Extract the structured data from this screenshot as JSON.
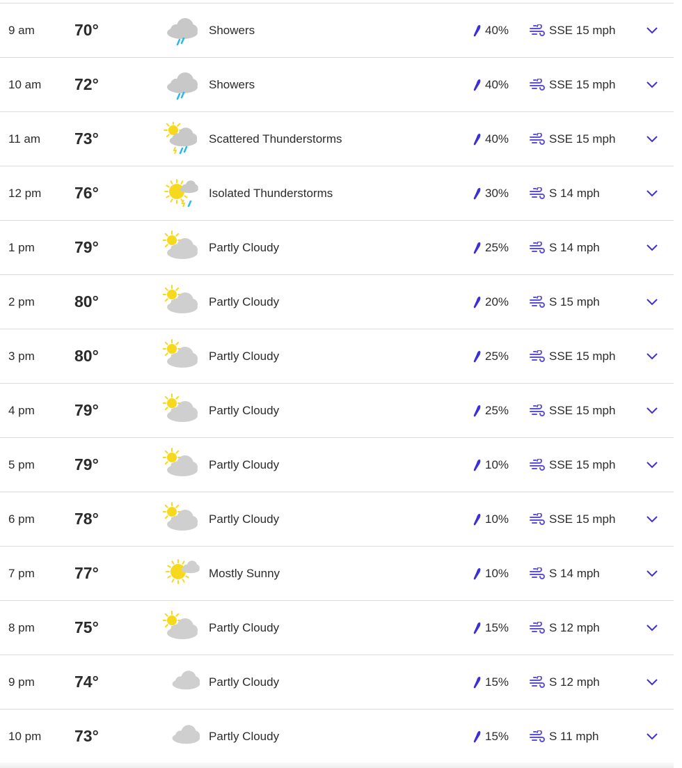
{
  "colors": {
    "accent": "#3d2fd6",
    "wind": "#5b4fe0",
    "divider": "#dcdcdc",
    "text": "#2b2b2b",
    "cloud": "#cfcfcf",
    "sun": "#f6d81c",
    "rain": "#2fb6e8"
  },
  "rows": [
    {
      "time": "9 am",
      "temp": "70°",
      "icon": "showers-icon",
      "condition": "Showers",
      "precip": "40%",
      "wind": "SSE 15 mph"
    },
    {
      "time": "10 am",
      "temp": "72°",
      "icon": "showers-icon",
      "condition": "Showers",
      "precip": "40%",
      "wind": "SSE 15 mph"
    },
    {
      "time": "11 am",
      "temp": "73°",
      "icon": "scattered-thunderstorms-icon",
      "condition": "Scattered Thunderstorms",
      "precip": "40%",
      "wind": "SSE 15 mph"
    },
    {
      "time": "12 pm",
      "temp": "76°",
      "icon": "isolated-thunderstorms-icon",
      "condition": "Isolated Thunderstorms",
      "precip": "30%",
      "wind": "S 14 mph"
    },
    {
      "time": "1 pm",
      "temp": "79°",
      "icon": "partly-cloudy-day-icon",
      "condition": "Partly Cloudy",
      "precip": "25%",
      "wind": "S 14 mph"
    },
    {
      "time": "2 pm",
      "temp": "80°",
      "icon": "partly-cloudy-day-icon",
      "condition": "Partly Cloudy",
      "precip": "20%",
      "wind": "S 15 mph"
    },
    {
      "time": "3 pm",
      "temp": "80°",
      "icon": "partly-cloudy-day-icon",
      "condition": "Partly Cloudy",
      "precip": "25%",
      "wind": "SSE 15 mph"
    },
    {
      "time": "4 pm",
      "temp": "79°",
      "icon": "partly-cloudy-day-icon",
      "condition": "Partly Cloudy",
      "precip": "25%",
      "wind": "SSE 15 mph"
    },
    {
      "time": "5 pm",
      "temp": "79°",
      "icon": "partly-cloudy-day-icon",
      "condition": "Partly Cloudy",
      "precip": "10%",
      "wind": "SSE 15 mph"
    },
    {
      "time": "6 pm",
      "temp": "78°",
      "icon": "partly-cloudy-day-icon",
      "condition": "Partly Cloudy",
      "precip": "10%",
      "wind": "SSE 15 mph"
    },
    {
      "time": "7 pm",
      "temp": "77°",
      "icon": "mostly-sunny-icon",
      "condition": "Mostly Sunny",
      "precip": "10%",
      "wind": "S 14 mph"
    },
    {
      "time": "8 pm",
      "temp": "75°",
      "icon": "partly-cloudy-day-icon",
      "condition": "Partly Cloudy",
      "precip": "15%",
      "wind": "S 12 mph"
    },
    {
      "time": "9 pm",
      "temp": "74°",
      "icon": "partly-cloudy-night-icon",
      "condition": "Partly Cloudy",
      "precip": "15%",
      "wind": "S 12 mph"
    },
    {
      "time": "10 pm",
      "temp": "73°",
      "icon": "partly-cloudy-night-icon",
      "condition": "Partly Cloudy",
      "precip": "15%",
      "wind": "S 11 mph"
    }
  ]
}
